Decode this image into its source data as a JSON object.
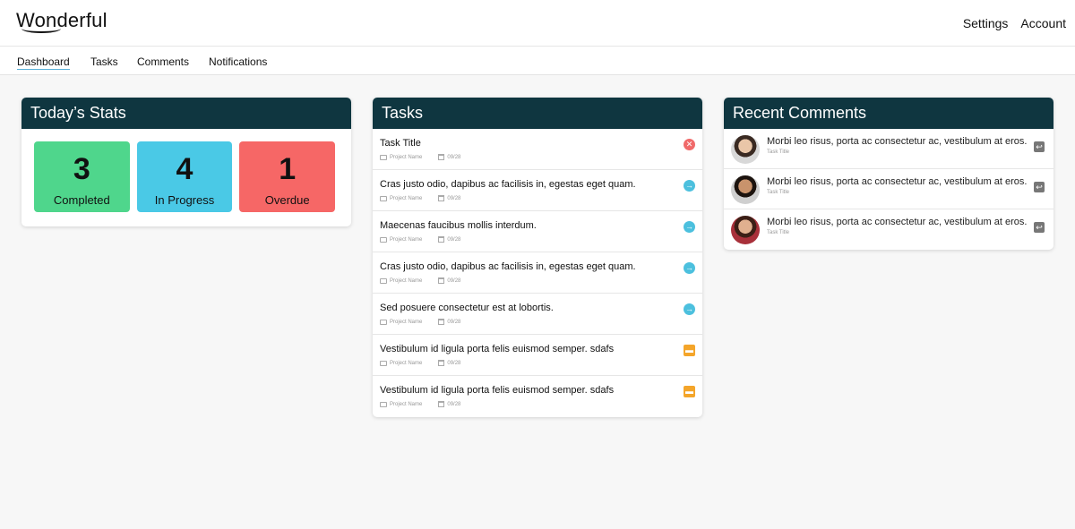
{
  "app": {
    "title": "Wonderful"
  },
  "topnav": {
    "settings": "Settings",
    "account": "Account"
  },
  "subnav": {
    "items": [
      "Dashboard",
      "Tasks",
      "Comments",
      "Notifications"
    ]
  },
  "stats": {
    "title": "Today’s Stats",
    "items": [
      {
        "value": "3",
        "label": "Completed",
        "color": "#4fd68c"
      },
      {
        "value": "4",
        "label": "In Progress",
        "color": "#4ac9e6"
      },
      {
        "value": "1",
        "label": "Overdue",
        "color": "#f66766"
      }
    ]
  },
  "tasks": {
    "title": "Tasks",
    "items": [
      {
        "title": "Task Title",
        "project": "Project Name",
        "date": "09/28",
        "status": "close-icon"
      },
      {
        "title": "Cras justo odio, dapibus ac facilisis in, egestas eget quam.",
        "project": "Project Name",
        "date": "09/28",
        "status": "arrow-right-icon"
      },
      {
        "title": "Maecenas faucibus mollis interdum.",
        "project": "Project Name",
        "date": "09/28",
        "status": "arrow-right-icon"
      },
      {
        "title": "Cras justo odio, dapibus ac facilisis in, egestas eget quam.",
        "project": "Project Name",
        "date": "09/28",
        "status": "arrow-right-icon"
      },
      {
        "title": "Sed posuere consectetur est at lobortis.",
        "project": "Project Name",
        "date": "09/28",
        "status": "arrow-right-icon"
      },
      {
        "title": "Vestibulum id ligula porta felis euismod semper.  sdafs",
        "project": "Project Name",
        "date": "09/28",
        "status": "archive-icon"
      },
      {
        "title": "Vestibulum id ligula porta felis euismod semper.  sdafs",
        "project": "Project Name",
        "date": "09/28",
        "status": "archive-icon"
      }
    ]
  },
  "comments": {
    "title": "Recent Comments",
    "items": [
      {
        "text": "Morbi leo risus, porta ac consectetur ac, vestibulum at eros.",
        "task": "Task Title"
      },
      {
        "text": "Morbi leo risus, porta ac consectetur ac, vestibulum at eros.",
        "task": "Task Title"
      },
      {
        "text": "Morbi leo risus, porta ac consectetur ac, vestibulum at eros.",
        "task": "Task Title"
      }
    ]
  }
}
